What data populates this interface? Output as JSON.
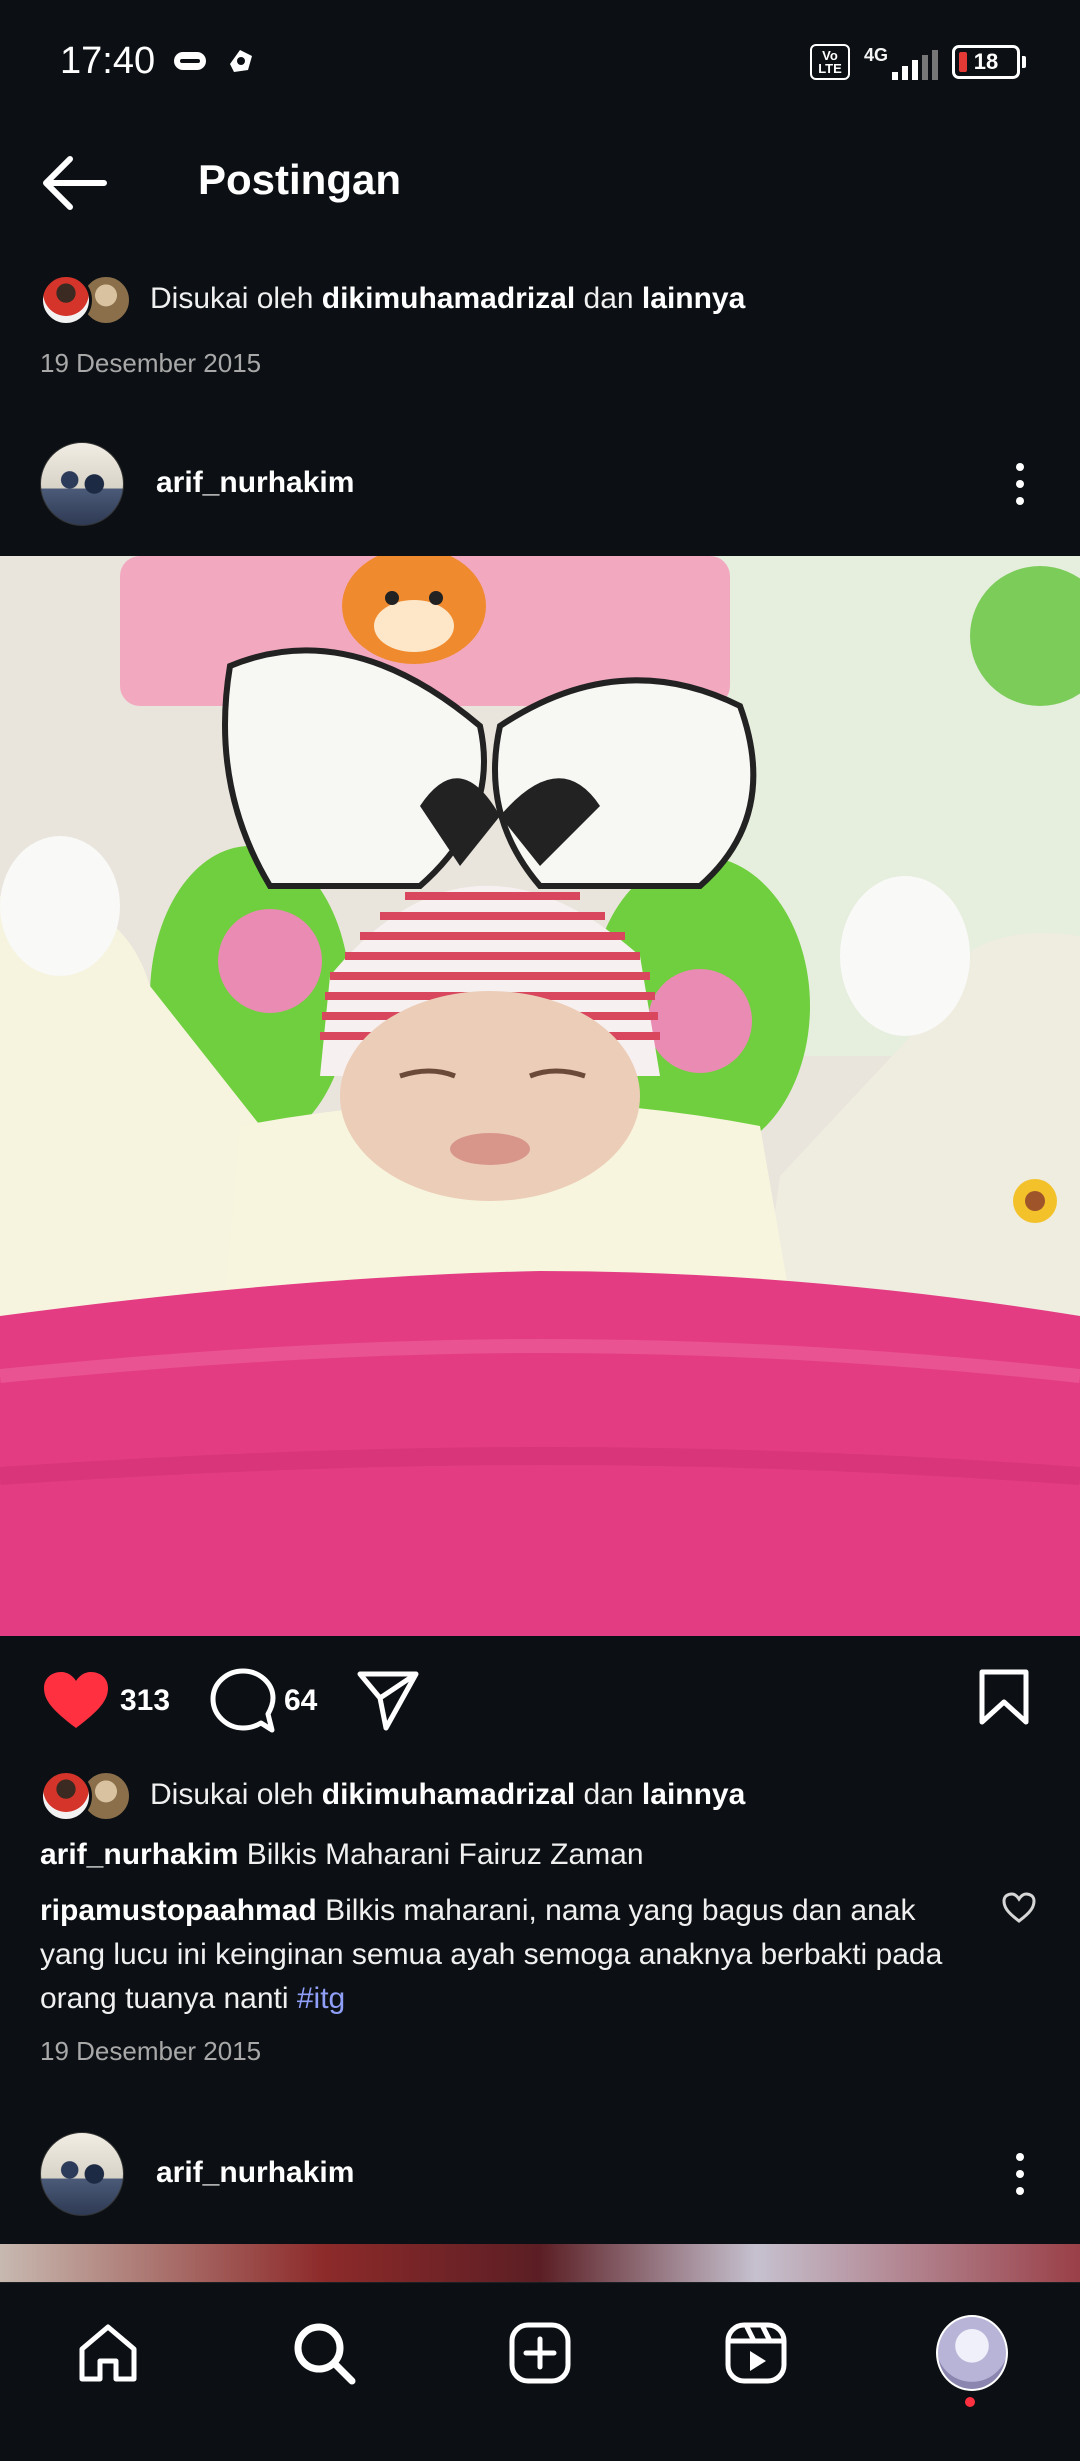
{
  "status_bar": {
    "time": "17:40",
    "left_icons": [
      "axis-icon",
      "dashboard-icon"
    ],
    "volte_label": "Vo LTE",
    "network": "4G",
    "signal_icon": "signal-bars-icon",
    "battery": "18"
  },
  "header": {
    "back_icon": "arrow-left-icon",
    "title": "Postingan"
  },
  "previous_post": {
    "liked_by_prefix": "Disukai oleh",
    "liked_by_user": "dikimuhamadrizal",
    "liked_by_and": "dan",
    "liked_by_others": "lainnya",
    "date": "19 Desember 2015"
  },
  "post": {
    "username": "arif_nurhakim",
    "menu_icon": "more-vertical-icon",
    "likes": "313",
    "comments": "64",
    "liked_by_prefix": "Disukai oleh",
    "liked_by_user": "dikimuhamadrizal",
    "liked_by_and": "dan",
    "liked_by_others": "lainnya",
    "caption_user": "arif_nurhakim",
    "caption_text": "Bilkis Maharani Fairuz Zaman",
    "comment_user": "ripamustopaahmad",
    "comment_text": "Bilkis maharani, nama yang bagus dan anak yang lucu ini keinginan semua ayah semoga anaknya berbakti pada orang tuanya nanti",
    "comment_hashtag": "#itg",
    "date": "19 Desember 2015",
    "icons": {
      "like": "heart-filled-icon",
      "comment": "comment-icon",
      "share": "send-icon",
      "save": "bookmark-icon",
      "comment_like": "heart-outline-icon"
    },
    "colors": {
      "like": "#ff3040",
      "hashtag": "#8f9ef7"
    }
  },
  "next_post": {
    "username": "arif_nurhakim"
  },
  "bottom_nav": {
    "items": [
      "home-icon",
      "search-icon",
      "create-icon",
      "reels-icon",
      "profile-avatar"
    ]
  }
}
